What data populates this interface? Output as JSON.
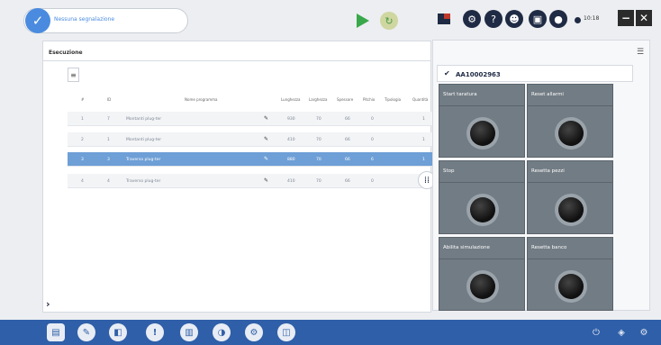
{
  "status": {
    "message": "Nessuna segnalazione"
  },
  "controls": {
    "play_icon": "play-icon",
    "reset_icon": "refresh-icon"
  },
  "header_icons": [
    {
      "name": "flag-icon",
      "glyph": "⚑"
    },
    {
      "name": "clock-settings-icon",
      "glyph": "⚙"
    },
    {
      "name": "help-icon",
      "glyph": "?"
    },
    {
      "name": "users-icon",
      "glyph": "☻"
    },
    {
      "name": "id-card-icon",
      "glyph": "▣"
    },
    {
      "name": "user-icon",
      "glyph": "●"
    }
  ],
  "clock": {
    "time": "10:18"
  },
  "window": {
    "minimize_label": "−",
    "close_label": "✕"
  },
  "execution": {
    "title": "Esecuzione",
    "list_icon_label": "≡",
    "columns": [
      "#",
      "ID",
      "Nome programma",
      "Lunghezza",
      "Larghezza",
      "Spessore",
      "Pitchio",
      "Tipologia",
      "Quantità"
    ],
    "rows": [
      {
        "index": "1",
        "id": "7",
        "name": "Montanti plug-ter",
        "length": "930",
        "width": "70",
        "thickness": "66",
        "pitch": "0",
        "qty": "1",
        "selected": false
      },
      {
        "index": "2",
        "id": "1",
        "name": "Montanti plug-ter",
        "length": "410",
        "width": "70",
        "thickness": "66",
        "pitch": "0",
        "qty": "1",
        "selected": false
      },
      {
        "index": "3",
        "id": "3",
        "name": "Traverso plug-ter",
        "length": "880",
        "width": "70",
        "thickness": "66",
        "pitch": "6",
        "qty": "1",
        "selected": true
      },
      {
        "index": "4",
        "id": "4",
        "name": "Traverso plug-ter",
        "length": "410",
        "width": "70",
        "thickness": "66",
        "pitch": "0",
        "qty": "1",
        "selected": false
      }
    ]
  },
  "device": {
    "id": "AA10002963",
    "commands": [
      {
        "label": "Start taratura"
      },
      {
        "label": "Reset allarmi"
      },
      {
        "label": "Stop"
      },
      {
        "label": "Resetta pezzi"
      },
      {
        "label": "Abilita simulazione"
      },
      {
        "label": "Resetta banco"
      }
    ]
  },
  "bottom_bar": {
    "icons": [
      {
        "name": "program-list-icon",
        "glyph": "▤"
      },
      {
        "name": "edit-icon",
        "glyph": "✎"
      },
      {
        "name": "cube-icon",
        "glyph": "◧"
      },
      {
        "name": "alert-icon",
        "glyph": "!"
      },
      {
        "name": "stats-icon",
        "glyph": "▥"
      },
      {
        "name": "tools-icon",
        "glyph": "◑"
      },
      {
        "name": "settings-gear-icon",
        "glyph": "⚙"
      },
      {
        "name": "machine-icon",
        "glyph": "◫"
      }
    ],
    "right_icons": [
      {
        "name": "power-icon",
        "glyph": "⏻"
      },
      {
        "name": "shield-icon",
        "glyph": "◈"
      },
      {
        "name": "gear-icon",
        "glyph": "⚙"
      }
    ]
  },
  "colors": {
    "accent": "#4a8be0",
    "selected_row": "#6e9fd6",
    "bottom_bar": "#2f5fa8",
    "command_button": "#727c84",
    "play": "#3aa84a"
  }
}
